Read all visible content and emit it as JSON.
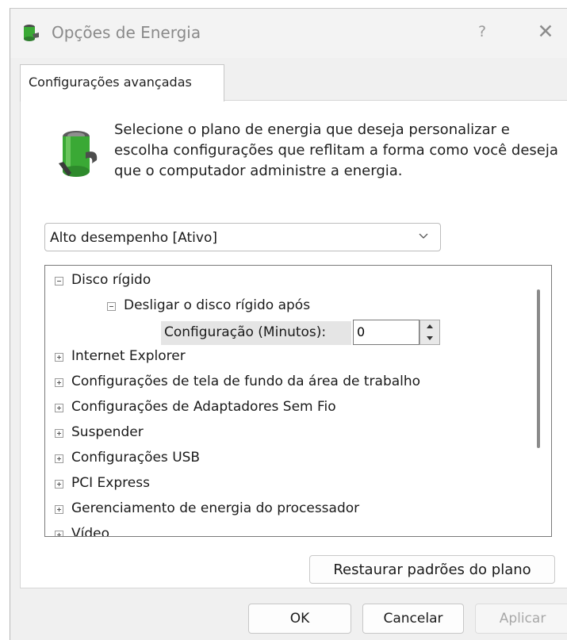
{
  "window": {
    "title": "Opções de Energia",
    "help_label": "?",
    "close_label": "✕"
  },
  "tabs": [
    {
      "label": "Configurações avançadas",
      "active": true
    }
  ],
  "description": "Selecione o plano de energia que deseja personalizar e escolha configurações que reflitam a forma como você deseja que o computador administre a energia.",
  "plan_select": {
    "value": "Alto desempenho [Ativo]"
  },
  "tree": {
    "items": [
      {
        "label": "Disco rígido",
        "expanded": true
      },
      {
        "label": "Desligar o disco rígido após",
        "expanded": true
      },
      {
        "label": "Internet Explorer",
        "expanded": false
      },
      {
        "label": "Configurações de tela de fundo da área de trabalho",
        "expanded": false
      },
      {
        "label": "Configurações de Adaptadores Sem Fio",
        "expanded": false
      },
      {
        "label": "Suspender",
        "expanded": false
      },
      {
        "label": "Configurações USB",
        "expanded": false
      },
      {
        "label": "PCI Express",
        "expanded": false
      },
      {
        "label": "Gerenciamento de energia do processador",
        "expanded": false
      },
      {
        "label": "Vídeo",
        "expanded": false
      }
    ],
    "setting": {
      "label": "Configuração (Minutos):",
      "value": "0"
    }
  },
  "buttons": {
    "restore": "Restaurar padrões do plano",
    "ok": "OK",
    "cancel": "Cancelar",
    "apply": "Aplicar"
  },
  "colors": {
    "battery_green": "#3aa935",
    "battery_cap": "#2e6e34",
    "window_bg": "#f0f0f0",
    "disabled_text": "#a8a8a8"
  }
}
